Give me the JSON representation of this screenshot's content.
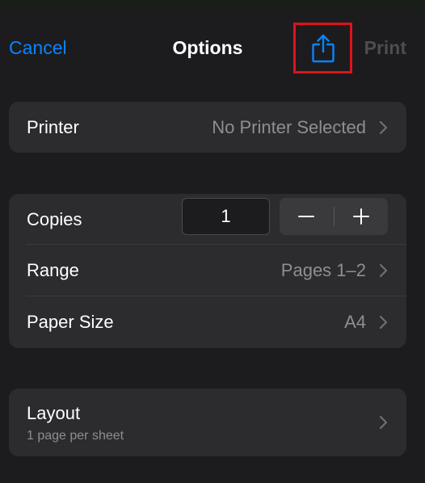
{
  "nav": {
    "cancel": "Cancel",
    "title": "Options",
    "print": "Print",
    "share_icon": "share-icon"
  },
  "printer": {
    "label": "Printer",
    "value": "No Printer Selected"
  },
  "copies": {
    "label": "Copies",
    "value": "1",
    "decrement_icon": "minus-icon",
    "increment_icon": "plus-icon"
  },
  "range": {
    "label": "Range",
    "value": "Pages 1–2"
  },
  "paper_size": {
    "label": "Paper Size",
    "value": "A4"
  },
  "layout": {
    "label": "Layout",
    "sub": "1 page per sheet"
  },
  "colors": {
    "accent": "#0a84ff",
    "highlight": "#e0121b",
    "background": "#1c1c1e",
    "card": "#2c2c2e"
  }
}
